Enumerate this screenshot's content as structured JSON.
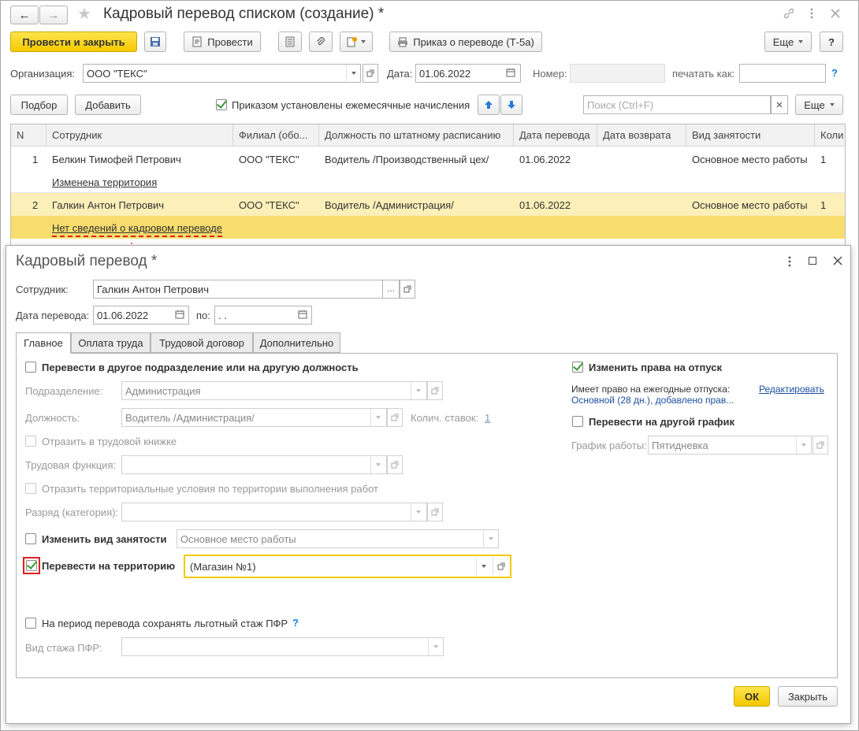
{
  "window": {
    "title": "Кадровый перевод списком (создание) *",
    "nav_back": "←",
    "nav_forward": "→",
    "star": "★"
  },
  "toolbar": {
    "post_close": "Провести и закрыть",
    "post": "Провести",
    "print_order": "Приказ о переводе (Т-5а)",
    "more": "Еще",
    "help": "?"
  },
  "header": {
    "org_label": "Организация:",
    "org_value": "ООО \"ТЕКС\"",
    "date_label": "Дата:",
    "date_value": "01.06.2022",
    "number_label": "Номер:",
    "number_value": "",
    "print_as_label": "печатать как:",
    "print_as_value": "",
    "help": "?"
  },
  "list_toolbar": {
    "select": "Подбор",
    "add": "Добавить",
    "monthly_checkbox_label": "Приказом установлены ежемесячные начисления",
    "search_placeholder": "Поиск (Ctrl+F)",
    "more": "Еще"
  },
  "table": {
    "columns": [
      "N",
      "Сотрудник",
      "Филиал (обо...",
      "Должность по штатному расписанию",
      "Дата перевода",
      "Дата возврата",
      "Вид занятости",
      "Коли"
    ],
    "rows": [
      {
        "n": "1",
        "employee": "Белкин Тимофей Петрович",
        "branch": "ООО \"ТЕКС\"",
        "position": "Водитель /Производственный цех/",
        "date": "01.06.2022",
        "return": "",
        "type": "Основное место работы",
        "qty": "1",
        "note": "Изменена территория"
      },
      {
        "n": "2",
        "employee": "Галкин Антон Петрович",
        "branch": "ООО \"ТЕКС\"",
        "position": "Водитель /Администрация/",
        "date": "01.06.2022",
        "return": "",
        "type": "Основное место работы",
        "qty": "1",
        "note": "Нет сведений о кадровом переводе"
      }
    ]
  },
  "dialog": {
    "title": "Кадровый перевод *",
    "employee_label": "Сотрудник:",
    "employee_value": "Галкин Антон Петрович",
    "date_label": "Дата перевода:",
    "date_value": "01.06.2022",
    "to_label": "по:",
    "to_value": " .  .",
    "tabs": [
      "Главное",
      "Оплата труда",
      "Трудовой договор",
      "Дополнительно"
    ],
    "transfer_dept_label": "Перевести в другое подразделение или на другую должность",
    "dept_label": "Подразделение:",
    "dept_value": "Администрация",
    "position_label": "Должность:",
    "position_value": "Водитель /Администрация/",
    "rates_label": "Колич. ставок:",
    "rates_value": "1",
    "workbook_label": "Отразить в трудовой книжке",
    "labor_func_label": "Трудовая функция:",
    "territorial_label": "Отразить территориальные условия по территории выполнения работ",
    "grade_label": "Разряд (категория):",
    "change_emp_type_label": "Изменить вид занятости",
    "emp_type_value": "Основное место работы",
    "transfer_territory_label": "Перевести на территорию",
    "territory_value": "(Магазин №1)",
    "pfr_label": "На период перевода сохранять льготный стаж ПФР",
    "pfr_help": "?",
    "pfr_type_label": "Вид стажа ПФР:",
    "vacation_label": "Изменить права на отпуск",
    "vacation_info_label": "Имеет право на ежегодные отпуска:",
    "vacation_edit": "Редактировать",
    "vacation_value": "Основной (28 дн.), добавлено прав...",
    "schedule_check_label": "Перевести на другой график",
    "schedule_label": "График работы:",
    "schedule_value": "Пятидневка",
    "ok": "ОК",
    "close": "Закрыть"
  },
  "colors": {
    "accent_yellow": "#f5c900",
    "highlight_row": "#fcefb8",
    "error_red": "#e02020",
    "link_blue": "#1a4fa0"
  }
}
